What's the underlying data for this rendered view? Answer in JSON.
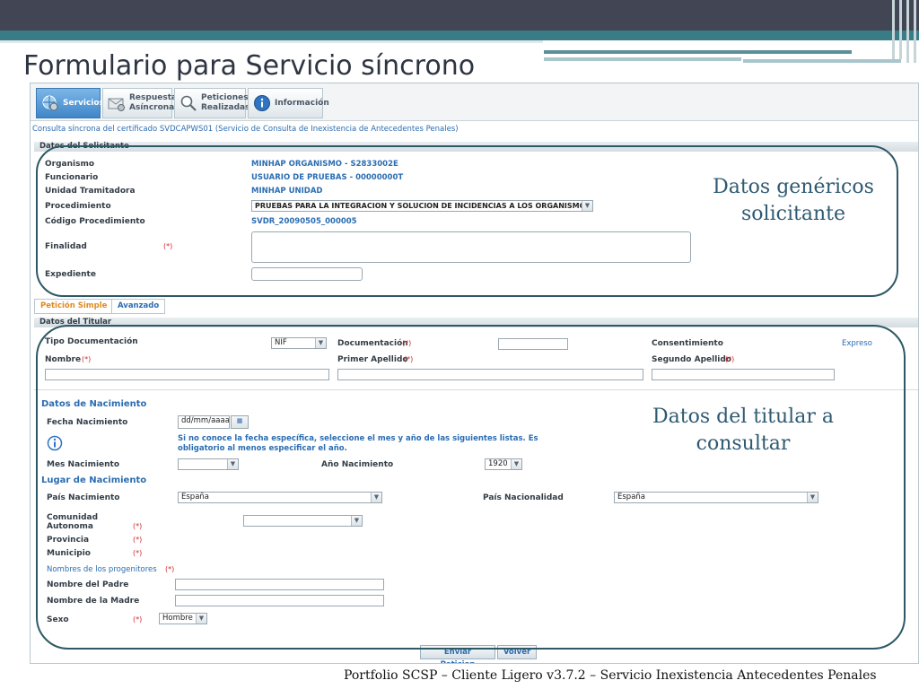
{
  "slide": {
    "title": "Formulario para Servicio síncrono",
    "footer": "Portfolio SCSP – Cliente Ligero v3.7.2 – Servicio  Inexistencia Antecedentes Penales"
  },
  "tabs": [
    {
      "label": "Servicios",
      "icon": "gear-globe-icon"
    },
    {
      "label": "Respuestas Asíncronas",
      "icon": "envelope-icon"
    },
    {
      "label": "Peticiones Realizadas",
      "icon": "magnifier-icon"
    },
    {
      "label": "Información",
      "icon": "info-icon"
    }
  ],
  "subtitle": "Consulta síncrona del certificado SVDCAPWS01 (Servicio de Consulta de Inexistencia de Antecedentes Penales)",
  "solicitante": {
    "header": "Datos del Solicitante",
    "organismo_label": "Organismo",
    "organismo_value": "MINHAP ORGANISMO - S2833002E",
    "funcionario_label": "Funcionario",
    "funcionario_value": "USUARIO DE PRUEBAS - 00000000T",
    "unidad_label": "Unidad Tramitadora",
    "unidad_value": "MINHAP UNIDAD",
    "procedimiento_label": "Procedimiento",
    "procedimiento_value": "PRUEBAS PARA LA INTEGRACION Y SOLUCION DE INCIDENCIAS A LOS ORGANISMOS",
    "codigo_label": "Código Procedimiento",
    "codigo_value": "SVDR_20090505_000005",
    "finalidad_label": "Finalidad",
    "required_mark": "(*)",
    "expediente_label": "Expediente"
  },
  "subtabs": {
    "simple": "Petición Simple",
    "avanzado": "Avanzado"
  },
  "titular": {
    "header": "Datos del Titular",
    "tipo_doc_label": "Tipo Documentación",
    "tipo_doc_value": "NIF",
    "documentacion_label": "Documentación",
    "consentimiento_label": "Consentimiento",
    "consentimiento_value": "Expreso",
    "nombre_label": "Nombre",
    "primer_apellido_label": "Primer Apellido",
    "segundo_apellido_label": "Segundo Apellido"
  },
  "nacimiento": {
    "title": "Datos de Nacimiento",
    "fecha_label": "Fecha Nacimiento",
    "fecha_placeholder": "dd/mm/aaaa",
    "info_text": "Si no conoce la fecha específica, seleccione el mes y año de las siguientes listas. Es obligatorio al menos especificar el año.",
    "mes_label": "Mes Nacimiento",
    "anio_label": "Año Nacimiento",
    "anio_value": "1920",
    "lugar_title": "Lugar de Nacimiento",
    "pais_label": "País Nacimiento",
    "pais_value": "España",
    "nacionalidad_label": "País Nacionalidad",
    "nacionalidad_value": "España",
    "comunidad_label": "Comunidad Autonoma",
    "provincia_label": "Provincia",
    "municipio_label": "Municipio",
    "progenitores_title": "Nombres de los progenitores",
    "padre_label": "Nombre del Padre",
    "madre_label": "Nombre de la Madre",
    "sexo_label": "Sexo",
    "sexo_value": "Hombre"
  },
  "buttons": {
    "enviar": "Enviar Peticion",
    "volver": "Volver"
  },
  "annotations": {
    "solicitante": "Datos genéricos solicitante",
    "titular": "Datos del titular a consultar"
  },
  "colors": {
    "accent_blue": "#2b6db2",
    "required_red": "#d0262b",
    "annotation_oval": "#2d5866",
    "topbar": "#414554",
    "teal_band": "#3a7c86"
  }
}
